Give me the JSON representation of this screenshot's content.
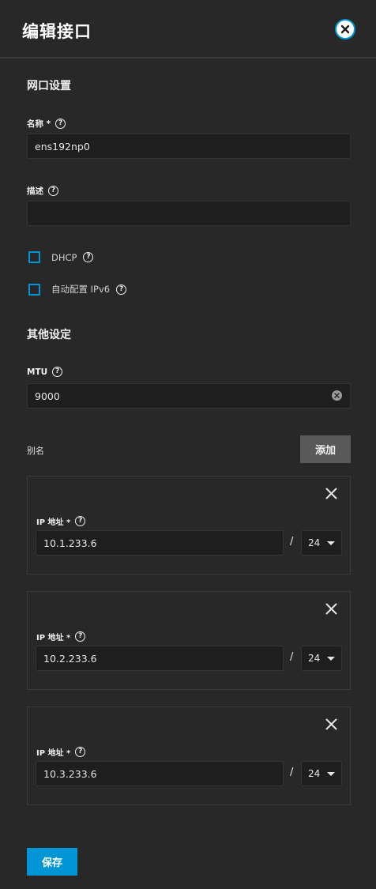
{
  "header": {
    "title": "编辑接口"
  },
  "sections": {
    "network": "网口设置",
    "other": "其他设定"
  },
  "fields": {
    "name": {
      "label": "名称 *",
      "value": "ens192np0"
    },
    "description": {
      "label": "描述",
      "value": ""
    },
    "dhcp": {
      "label": "DHCP",
      "checked": false
    },
    "autoconfig_ipv6": {
      "label": "自动配置 IPv6",
      "checked": false
    },
    "mtu": {
      "label": "MTU",
      "value": "9000"
    }
  },
  "aliases": {
    "label": "别名",
    "add_label": "添加",
    "items": [
      {
        "label": "IP 地址 *",
        "ip": "10.1.233.6",
        "mask": "24"
      },
      {
        "label": "IP 地址 *",
        "ip": "10.2.233.6",
        "mask": "24"
      },
      {
        "label": "IP 地址 *",
        "ip": "10.3.233.6",
        "mask": "24"
      }
    ],
    "separator": "/"
  },
  "help_glyph": "?",
  "footer": {
    "save_label": "保存"
  },
  "colors": {
    "accent": "#0095d5",
    "background": "#282828",
    "input": "#1e1e1e",
    "secondary_button": "#595959"
  }
}
